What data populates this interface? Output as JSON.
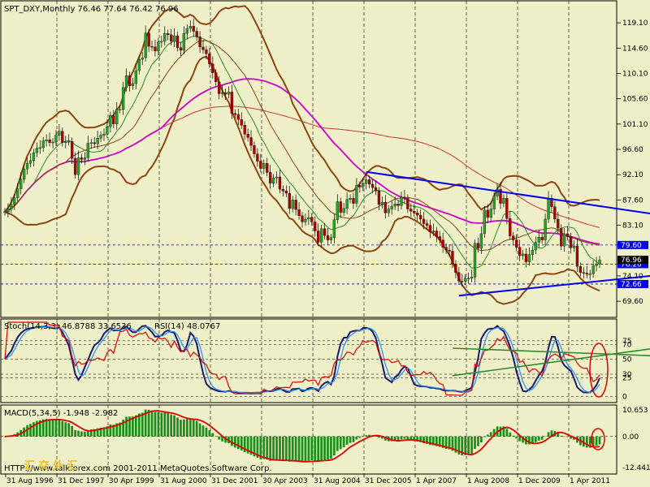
{
  "window": {
    "symbol_header": "SPT_DXY,Monthly  76.46 77.64 76.42 76.96",
    "stoch_header": "Stoch(14,3,3) 46.8788 33.6536",
    "rsi_header": "RSI(14) 48.0767",
    "macd_header": "MACD(5,34,5) -1.948 -2.982",
    "copyright": "HTTP://www.talkforex.com 2001-2011 MetaQuotes Software Corp.",
    "watermark": "汇 交 外 汇"
  },
  "colors": {
    "panel_bg": "#efefc8",
    "price_pane_bg": "#f0f0c8",
    "grid": "#000000",
    "bollinger": "#8b4513",
    "ma_slow": "#cc00cc",
    "ma_200": "#cc3333",
    "ma_fast": "#2e8b2e",
    "trendline": "#0000ee",
    "stoch_main": "#1a1a6e",
    "stoch_signal": "#1e90ff",
    "rsi": "#e00000",
    "macd_bar": "#1a8f1a",
    "macd_signal": "#e00000",
    "highlight_ellipse": "#e00000"
  },
  "chart_data": [
    {
      "type": "candlestick",
      "title": "SPT_DXY,Monthly",
      "ohlc_last": {
        "open": 76.46,
        "high": 77.64,
        "low": 76.42,
        "close": 76.96
      },
      "x_tick_labels": [
        "31 Aug 1996",
        "31 Dec 1997",
        "30 Apr 1999",
        "31 Aug 2000",
        "31 Dec 2001",
        "30 Apr 2003",
        "31 Aug 2004",
        "31 Dec 2005",
        "1 Apr 2007",
        "1 Aug 2008",
        "1 Dec 2009",
        "1 Apr 2011"
      ],
      "y_tick_labels": [
        "119.10",
        "114.60",
        "110.10",
        "105.60",
        "101.10",
        "96.60",
        "92.10",
        "87.60",
        "83.10",
        "79.60",
        "76.20",
        "74.10",
        "72.66",
        "69.60"
      ],
      "ylim": [
        67.6,
        122.0
      ],
      "horizontal_levels": [
        79.6,
        76.2,
        72.66
      ],
      "current_price_label": "76.96",
      "indicators": [
        "Bollinger Bands",
        "Moving Average (magenta)",
        "Moving Average (red, long)",
        "Moving Average (green, short)"
      ],
      "trendlines": [
        "upper descending resistance",
        "lower ascending support"
      ],
      "closes": [
        85.5,
        86.0,
        86.8,
        88.0,
        89.6,
        91.3,
        93.1,
        94.1,
        94.6,
        96.0,
        96.8,
        96.9,
        98.1,
        98.3,
        97.8,
        97.9,
        99.1,
        99.8,
        97.8,
        98.0,
        98.0,
        95.0,
        92.1,
        95.1,
        94.8,
        95.1,
        97.7,
        97.8,
        97.6,
        98.6,
        99.1,
        99.3,
        100.6,
        102.6,
        101.1,
        103.7,
        103.7,
        107.6,
        109.7,
        107.9,
        108.3,
        110.6,
        112.6,
        112.9,
        117.3,
        114.9,
        114.8,
        114.1,
        115.7,
        115.8,
        117.2,
        117.0,
        115.8,
        116.8,
        114.7,
        114.2,
        117.2,
        118.1,
        118.5,
        117.6,
        116.6,
        114.8,
        114.3,
        113.6,
        111.8,
        110.2,
        108.6,
        106.5,
        106.7,
        106.4,
        106.8,
        103.0,
        102.8,
        101.9,
        100.9,
        99.3,
        98.7,
        97.3,
        95.8,
        94.5,
        93.2,
        94.1,
        92.5,
        90.6,
        91.5,
        91.7,
        89.5,
        89.2,
        88.8,
        86.1,
        87.6,
        85.9,
        84.8,
        83.7,
        84.2,
        84.5,
        83.7,
        82.1,
        80.1,
        82.5,
        81.3,
        80.5,
        80.9,
        84.1,
        87.3,
        85.4,
        86.1,
        87.7,
        87.9,
        87.0,
        90.2,
        89.9,
        90.5,
        91.2,
        90.4,
        89.8,
        89.2,
        86.8,
        87.2,
        85.3,
        86.0,
        86.5,
        86.9,
        86.6,
        88.1,
        87.9,
        86.0,
        85.6,
        85.3,
        84.9,
        84.2,
        83.4,
        83.1,
        81.9,
        82.1,
        81.1,
        80.5,
        79.2,
        78.7,
        78.5,
        76.2,
        74.7,
        73.2,
        73.2,
        73.7,
        73.7,
        73.9,
        79.9,
        79.0,
        81.6,
        85.8,
        84.5,
        86.0,
        88.3,
        89.5,
        87.0,
        87.9,
        84.3,
        81.2,
        80.5,
        79.2,
        77.7,
        78.0,
        76.6,
        77.9,
        78.7,
        80.1,
        81.0,
        80.5,
        84.2,
        87.9,
        86.4,
        84.2,
        82.6,
        79.4,
        81.6,
        81.1,
        79.1,
        79.4,
        75.8,
        74.7,
        74.6,
        74.4,
        74.5,
        75.9,
        76.2,
        76.96
      ]
    },
    {
      "type": "line",
      "title": "Stoch(14,3,3) / RSI(14)",
      "series": [
        {
          "name": "Stoch(14,3,3)",
          "last_values": [
            46.8788,
            33.6536
          ]
        },
        {
          "name": "RSI(14)",
          "last_value": 48.0767
        }
      ],
      "y_tick_labels": [
        "75",
        "70",
        "50",
        "30",
        "25",
        "0"
      ],
      "ylim": [
        -5,
        100
      ]
    },
    {
      "type": "bar",
      "title": "MACD(5,34,5)",
      "series": [
        {
          "name": "MACD(5,34,5)",
          "last_value": -1.948
        },
        {
          "name": "signal",
          "last_value": -2.982
        }
      ],
      "y_tick_labels": [
        "10.653",
        "0.00",
        "-12.441"
      ],
      "ylim": [
        -12.441,
        10.653
      ]
    }
  ]
}
